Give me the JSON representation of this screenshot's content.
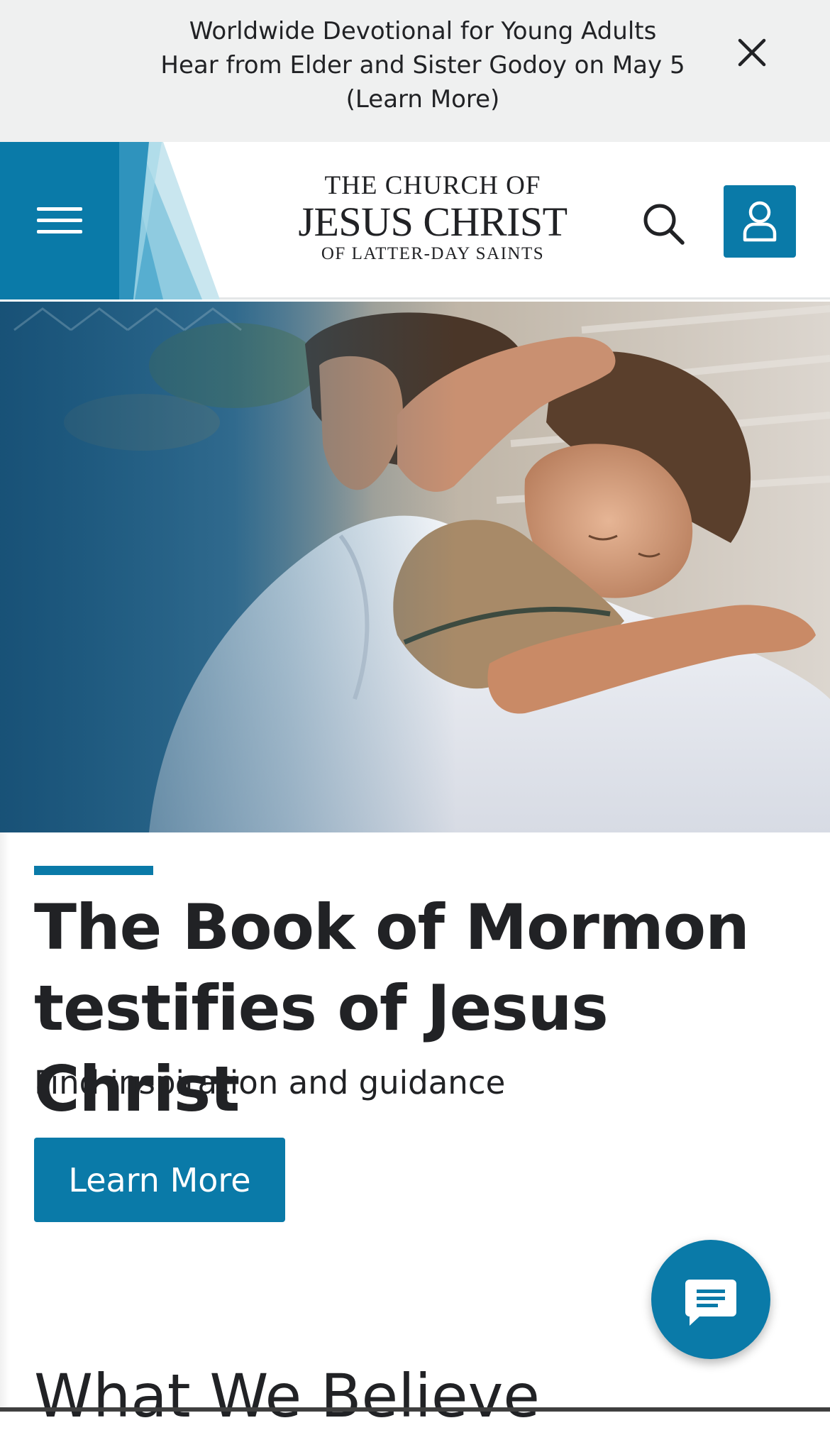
{
  "banner": {
    "line1": "Worldwide Devotional for Young Adults",
    "line2": "Hear from Elder and Sister Godoy on May 5",
    "link": "(Learn More)",
    "close_icon": "close-icon"
  },
  "header": {
    "menu_icon": "hamburger-menu-icon",
    "logo": {
      "line1": "THE CHURCH OF",
      "line2": "JESUS CHRIST",
      "line3": "OF LATTER-DAY SAINTS"
    },
    "search_icon": "search-icon",
    "account_icon": "user-icon"
  },
  "hero": {
    "image": "photo of Jesus Christ embracing a young girl",
    "title": "The Book of Mormon testifies of Jesus Christ",
    "subtitle": "Find inspiration and guidance",
    "button_label": "Learn More"
  },
  "chat": {
    "icon": "chat-icon"
  },
  "next_section": {
    "heading": "What We Believe"
  },
  "colors": {
    "brand_blue": "#0a7aa8",
    "banner_bg": "#eff0f0",
    "text": "#212225"
  }
}
